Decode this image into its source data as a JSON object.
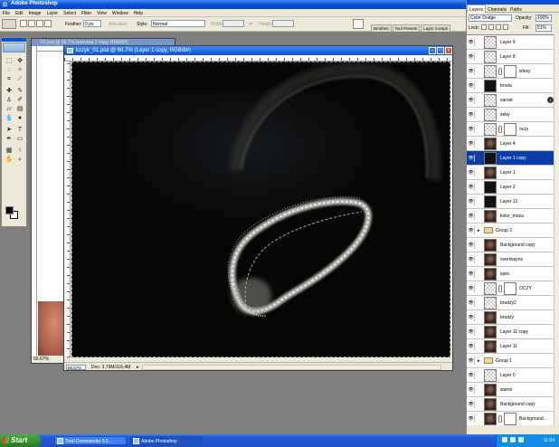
{
  "window": {
    "title": "Adobe Photoshop"
  },
  "menu": [
    "File",
    "Edit",
    "Image",
    "Layer",
    "Select",
    "Filter",
    "View",
    "Window",
    "Help"
  ],
  "options": {
    "feather_label": "Feather:",
    "feather_value": "0 px",
    "antialias_label": "Anti-alias",
    "style_label": "Style:",
    "style_value": "Normal",
    "width_label": "Width:",
    "height_label": "Height:"
  },
  "palette_wells": [
    "Brushes",
    "Tool Presets",
    "Layer Comps"
  ],
  "doc_back": {
    "title": "01.psd @ 66.7% (warstwa 1 copy, RGB/8#)",
    "zoom": "66.67%"
  },
  "doc": {
    "title": "kzzyk_01.psd @ 66.7% (Layer 1 copy, RGB/8#)",
    "zoom": "66.67%",
    "info": "Doc: 3,79M/116,4M"
  },
  "layers_palette": {
    "tabs": [
      "Layers",
      "Channels",
      "Paths"
    ],
    "blend_mode": "Color Dodge",
    "opacity_label": "Opacity:",
    "opacity_value": "100%",
    "lock_label": "Lock:",
    "fill_label": "Fill:",
    "fill_value": "51%",
    "layers": [
      {
        "name": "Layer 9",
        "thumb": "checker"
      },
      {
        "name": "Layer 8",
        "thumb": "checker"
      },
      {
        "name": "wlosy",
        "thumb": "checker",
        "mask": true
      },
      {
        "name": "broda",
        "thumb": "dark"
      },
      {
        "name": "zarost",
        "thumb": "checker",
        "fx": true
      },
      {
        "name": "zeby",
        "thumb": "checker"
      },
      {
        "name": "oczy",
        "thumb": "checker",
        "mask": true
      },
      {
        "name": "Layer 4",
        "thumb": "face"
      },
      {
        "name": "Layer 1 copy",
        "thumb": "dark",
        "selected": true
      },
      {
        "name": "Layer 1",
        "thumb": "face"
      },
      {
        "name": "Layer 2",
        "thumb": "dark"
      },
      {
        "name": "Layer 12",
        "thumb": "dark"
      },
      {
        "name": "kolor_moza",
        "thumb": "face"
      },
      {
        "name": "Group 2",
        "group": true
      },
      {
        "name": "Background copy",
        "thumb": "face"
      },
      {
        "name": "overlwayns",
        "thumb": "face"
      },
      {
        "name": "spec",
        "thumb": "face"
      },
      {
        "name": "OCZY",
        "thumb": "checker",
        "mask": true
      },
      {
        "name": "brudzy2",
        "thumb": "checker"
      },
      {
        "name": "brudzy",
        "thumb": "face"
      },
      {
        "name": "Layer 11 copy",
        "thumb": "face"
      },
      {
        "name": "Layer 11",
        "thumb": "face"
      },
      {
        "name": "Group 1",
        "group": true
      },
      {
        "name": "Layer 0",
        "thumb": "checker"
      },
      {
        "name": "wame",
        "thumb": "face"
      },
      {
        "name": "Background copy",
        "thumb": "face"
      },
      {
        "name": "Background...",
        "thumb": "face",
        "mask": true
      }
    ]
  },
  "taskbar": {
    "start": "Start",
    "tasks": [
      "Total Commander 6.5...",
      "Adobe Photoshop"
    ],
    "clock": "11:54"
  }
}
